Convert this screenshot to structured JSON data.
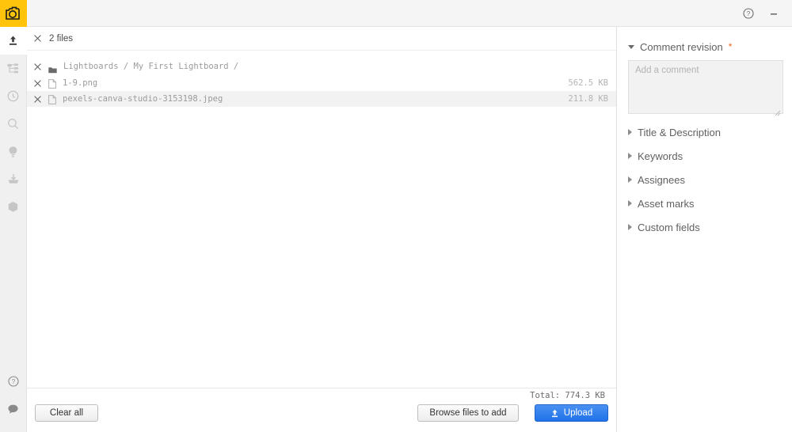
{
  "app": {
    "logo_icon": "camera-logo-icon",
    "brand_color": "#ffc40b"
  },
  "topbar": {
    "help_icon": "help-circle-icon",
    "minimize_icon": "minimize-icon"
  },
  "sidebar": {
    "items": [
      {
        "icon": "upload-icon",
        "name": "sidebar-item-upload",
        "active": true
      },
      {
        "icon": "tree-structure-icon",
        "name": "sidebar-item-browse",
        "active": false
      },
      {
        "icon": "clock-icon",
        "name": "sidebar-item-recent",
        "active": false
      },
      {
        "icon": "search-icon",
        "name": "sidebar-item-search",
        "active": false
      },
      {
        "icon": "lightbulb-icon",
        "name": "sidebar-item-lightboards",
        "active": false
      },
      {
        "icon": "download-icon",
        "name": "sidebar-item-downloads",
        "active": false
      },
      {
        "icon": "package-icon",
        "name": "sidebar-item-packages",
        "active": false
      }
    ],
    "bottom_items": [
      {
        "icon": "help-circle-icon",
        "name": "sidebar-item-help"
      },
      {
        "icon": "chat-bubble-icon",
        "name": "sidebar-item-feedback"
      }
    ]
  },
  "files": {
    "count_label": "2 files",
    "remove_icon": "close-x-icon",
    "folder_icon": "folder-icon",
    "file_icon": "file-icon",
    "breadcrumb": "Lightboards / My First Lightboard /",
    "rows": [
      {
        "name": "1-9.png",
        "size": "562.5 KB",
        "highlight": false
      },
      {
        "name": "pexels-canva-studio-3153198.jpeg",
        "size": "211.8 KB",
        "highlight": true
      }
    ],
    "total_label": "Total: 774.3 KB",
    "clear_all_label": "Clear all",
    "browse_label": "Browse files to add",
    "upload_label": "Upload",
    "upload_icon": "upload-icon",
    "upload_button_color": "#1f72e8"
  },
  "meta": {
    "sections": [
      {
        "label": "Comment revision",
        "expanded": true,
        "required": true
      },
      {
        "label": "Title & Description",
        "expanded": false,
        "required": false
      },
      {
        "label": "Keywords",
        "expanded": false,
        "required": false
      },
      {
        "label": "Assignees",
        "expanded": false,
        "required": false
      },
      {
        "label": "Asset marks",
        "expanded": false,
        "required": false
      },
      {
        "label": "Custom fields",
        "expanded": false,
        "required": false
      }
    ],
    "required_marker": "*",
    "required_color": "#f26722",
    "comment_placeholder": "Add a comment",
    "resize_grip_icon": "resize-grip-icon"
  }
}
